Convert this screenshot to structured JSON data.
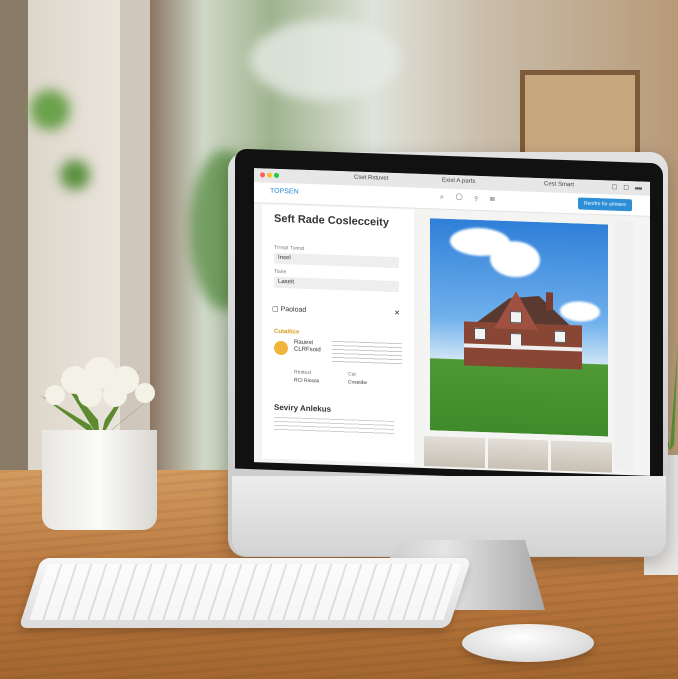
{
  "photo": {
    "description_text": ""
  },
  "monitor_screen": {
    "titlebar": {
      "left_text": "Cset Rstuvet",
      "center_text": "Exist A.parts",
      "right_text": "Cest Smart"
    },
    "toolbar": {
      "logo_text": "TOPSEN",
      "cta_label": "Rentfre for a/Intere"
    },
    "left_panel": {
      "title": "Seft Rade Coslecceity",
      "field1_label": "Trrmpt Tunrat",
      "field1_value": "Insel",
      "field2_label": "Tiarie",
      "field2_value": "Laseit",
      "payload_label": "Paoload",
      "section_heading": "Cutaltice",
      "feature_title": "Rauest CLRFsoid",
      "mini1_label": "Rtnttext",
      "mini1_value": "RCI Rinsas",
      "mini2_label": "Cat",
      "mini2_value": "Cvseidw",
      "section2_title": "Seviry Anlekus"
    }
  },
  "icons": {
    "apple": "apple-logo-icon",
    "payload": "document-icon",
    "close": "close-icon"
  }
}
